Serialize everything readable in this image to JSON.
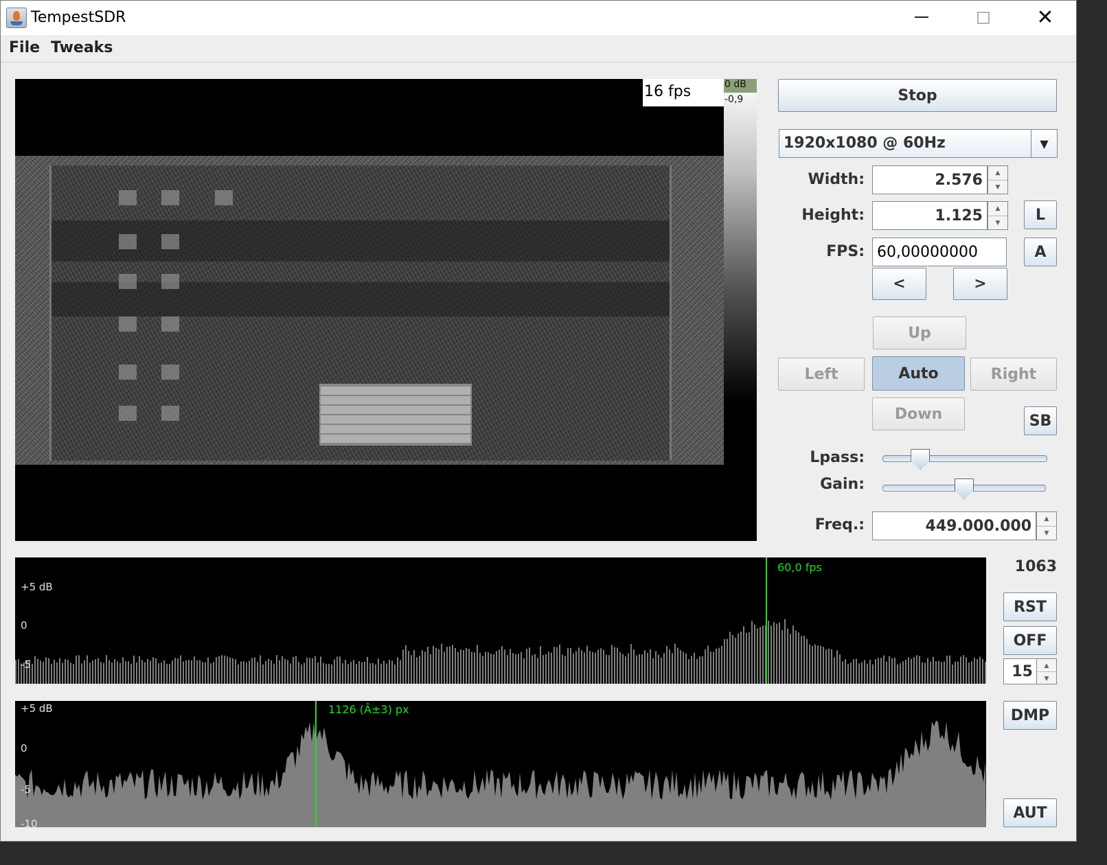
{
  "window": {
    "title": "TempestSDR"
  },
  "menu": {
    "file": "File",
    "tweaks": "Tweaks"
  },
  "viewport": {
    "fps_overlay": "16 fps",
    "db_top": "0 dB",
    "db_sub": "-0,9"
  },
  "controls": {
    "stop_label": "Stop",
    "resolution": "1920x1080 @ 60Hz",
    "width_label": "Width:",
    "width_value": "2.576",
    "height_label": "Height:",
    "height_value": "1.125",
    "fps_label": "FPS:",
    "fps_value": "60,00000000",
    "l_label": "L",
    "a_label": "A",
    "prev_label": "<",
    "next_label": ">",
    "up_label": "Up",
    "left_label": "Left",
    "auto_label": "Auto",
    "right_label": "Right",
    "down_label": "Down",
    "sb_label": "SB",
    "lpass_label": "Lpass:",
    "lpass_level": 0.23,
    "gain_label": "Gain:",
    "gain_level": 0.5,
    "freq_label": "Freq.:",
    "freq_value": "449.000.000"
  },
  "side": {
    "counter": "1063",
    "rst_label": "RST",
    "off_label": "OFF",
    "spin_value": "15",
    "dmp_label": "DMP",
    "aut_label": "AUT"
  },
  "fps_plot": {
    "marker_label": "60,0 fps",
    "tick_labels": [
      "+5 dB",
      "0",
      "-5"
    ]
  },
  "px_plot": {
    "marker_label": "1126 (Â±3) px",
    "tick_labels": [
      "+5 dB",
      "0",
      "-5",
      "-10"
    ]
  },
  "colors": {
    "accent": "#b9cde3",
    "marker": "#22dd22",
    "plot_fill": "#808080"
  }
}
